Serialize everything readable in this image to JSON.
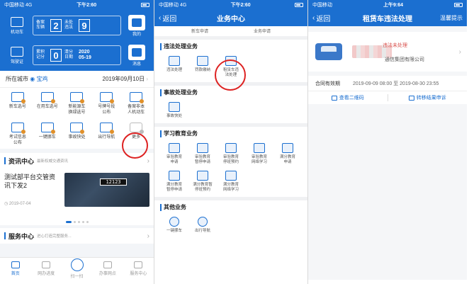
{
  "panel1": {
    "status": {
      "carrier": "中国移动",
      "net": "4G",
      "time": "下午2:60"
    },
    "hero": {
      "left_label_1": "机动车",
      "left_label_2": "驾驶证",
      "card1_label": "备案车辆",
      "card1_value": "2",
      "card1_label2": "未处违法",
      "card1_value2": "9",
      "card2_label": "累积记分",
      "card2_value": "0",
      "card2_label2": "清分日期",
      "card2_year": "2020",
      "card2_date": "05-19",
      "right_label_1": "我的",
      "right_label_2": "消息"
    },
    "city": {
      "label": "所在城市",
      "value": "宝鸡",
      "date": "2019年09月10日"
    },
    "grid": [
      {
        "label": "新车选号"
      },
      {
        "label": "在用车选号"
      },
      {
        "label": "新能源车\n换绿选号"
      },
      {
        "label": "号牌号段\n公布"
      },
      {
        "label": "备案非本\n人机动车"
      },
      {
        "label": "考试信息\n公布"
      },
      {
        "label": "一键挪车"
      },
      {
        "label": "事故快处"
      },
      {
        "label": "出行导航"
      },
      {
        "label": "更多"
      }
    ],
    "news_head": {
      "title": "资讯中心",
      "sub": "最新权威交通资讯"
    },
    "news": {
      "title": "测试部平台交管资讯下发2",
      "date": "2019-07-04",
      "plate": "12123"
    },
    "service_head": {
      "title": "服务中心",
      "sub": "进心打造完整服务..."
    },
    "tabs": [
      "首页",
      "网办进度",
      "扫一扫",
      "办事网点",
      "服务中心"
    ]
  },
  "panel2": {
    "status": {
      "carrier": "中国移动",
      "net": "4G",
      "time": "下午2:60"
    },
    "nav": {
      "back": "返回",
      "title": "业务中心"
    },
    "top_items": [
      "新车申请",
      "业务申请"
    ],
    "sections": [
      {
        "title": "违法处理业务",
        "items": [
          "违法处理",
          "罚款缴纳",
          "租赁车违\n法处理"
        ]
      },
      {
        "title": "事故处理业务",
        "items": [
          "事故快处"
        ]
      },
      {
        "title": "学习教育业务",
        "items": [
          "审验教育\n申请",
          "审验教育\n暂停申请",
          "审验教育\n停班预约",
          "审验教育\n网络学习",
          "满分教育\n申请",
          "满分教育\n暂停申请",
          "满分教育暂\n停班预约",
          "满分教育\n网络学习"
        ]
      },
      {
        "title": "其他业务",
        "items": [
          "一键挪车",
          "出行导航"
        ]
      }
    ]
  },
  "panel3": {
    "status": {
      "carrier": "中国移动",
      "time": "上午9:64"
    },
    "nav": {
      "back": "返回",
      "title": "租赁车违法处理",
      "right": "温馨提示"
    },
    "card": {
      "badge": "违法未处理",
      "company": "通信集团有限公司"
    },
    "contract": {
      "label": "合同有效期",
      "value": "2019-09-09 08:00 至 2019-08-30 23:55"
    },
    "actions": {
      "qr": "查看二维码",
      "transfer": "转移结果申诉"
    }
  },
  "colors": {
    "primary": "#1b6fd0",
    "alert": "#d22222"
  }
}
